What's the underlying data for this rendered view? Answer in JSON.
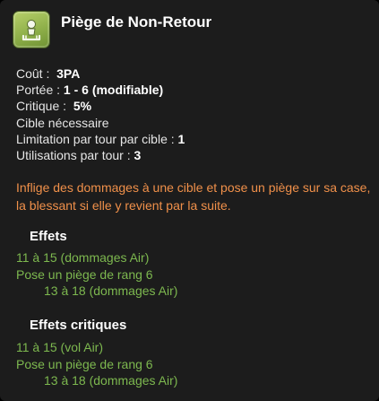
{
  "spell": {
    "icon": "trap-spell-icon",
    "name": "Piège de Non-Retour"
  },
  "stats": [
    {
      "label": "Coût :",
      "value": "3PA"
    },
    {
      "label": "Portée :",
      "value": "1 - 6 (modifiable)"
    },
    {
      "label": "Critique :",
      "value": "5%"
    },
    {
      "label": "Cible nécessaire",
      "value": ""
    },
    {
      "label": "Limitation par tour par cible :",
      "value": "1"
    },
    {
      "label": "Utilisations par tour :",
      "value": "3"
    }
  ],
  "description": "Inflige des dommages à une cible et pose un piège sur sa case, la blessant si elle y revient par la suite.",
  "effects": {
    "title": "Effets",
    "lines": [
      "11 à 15 (dommages Air)",
      "Pose un piège de rang 6",
      "13 à 18 (dommages Air)"
    ]
  },
  "critical_effects": {
    "title": "Effets critiques",
    "lines": [
      "11 à 15 (vol Air)",
      "Pose un piège de rang 6",
      "13 à 18 (dommages Air)"
    ]
  },
  "colors": {
    "background": "#1c1c1c",
    "description": "#f0904a",
    "effects": "#7db84f",
    "icon": "#9fbf58"
  }
}
